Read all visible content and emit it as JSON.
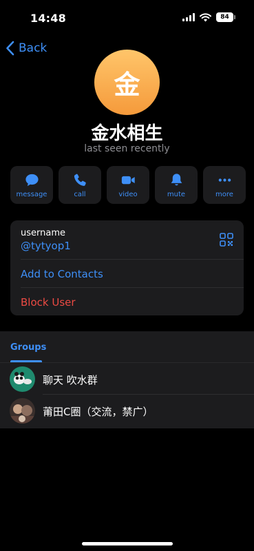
{
  "status_bar": {
    "time": "14:48",
    "battery": "84"
  },
  "nav": {
    "back_label": "Back"
  },
  "profile": {
    "avatar_letter": "金",
    "name": "金水相生",
    "last_seen": "last seen recently"
  },
  "actions": [
    {
      "label": "message",
      "icon": "message-bubble-icon"
    },
    {
      "label": "call",
      "icon": "phone-icon"
    },
    {
      "label": "video",
      "icon": "video-camera-icon"
    },
    {
      "label": "mute",
      "icon": "bell-icon"
    },
    {
      "label": "more",
      "icon": "more-dots-icon"
    }
  ],
  "info": {
    "username_label": "username",
    "username_value": "@tytyop1",
    "add_contacts": "Add to Contacts",
    "block_user": "Block User"
  },
  "groups": {
    "tab_label": "Groups",
    "items": [
      {
        "name": "聊天 吹水群"
      },
      {
        "name": "莆田C圈（交流，禁广）"
      }
    ]
  },
  "colors": {
    "accent": "#3e8ff7",
    "danger": "#ec4a43",
    "avatar_top": "#ffc56a",
    "avatar_bottom": "#f59a3b"
  }
}
